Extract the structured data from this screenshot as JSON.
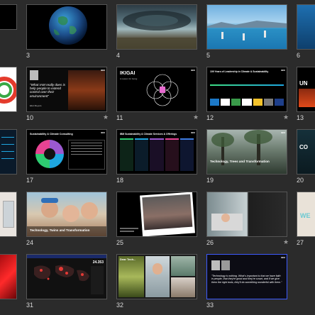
{
  "slides": [
    {
      "number": "3"
    },
    {
      "number": "4"
    },
    {
      "number": "5"
    },
    {
      "number": "6"
    },
    {
      "number": "10",
      "quote": "\"What IAM really does is help people to extend control over their environment\"",
      "author": "Eliot Meyers"
    },
    {
      "number": "11",
      "title": "IKIGAI",
      "subtitle": "A reason for being"
    },
    {
      "number": "12",
      "title": "109 Years of Leadership in Climate & Sustainability"
    },
    {
      "number": "13",
      "title": "UN"
    },
    {
      "number": "17",
      "title": "Sustainability & Climate Consulting"
    },
    {
      "number": "18",
      "title": "IBM Sustainability & Climate Services & Offerings"
    },
    {
      "number": "19",
      "title": "Technology, Trees and Transformation"
    },
    {
      "number": "20",
      "title": "CO"
    },
    {
      "number": "24",
      "title": "Technology, Twins and Transformation"
    },
    {
      "number": "25"
    },
    {
      "number": "26"
    },
    {
      "number": "27",
      "title": "WE"
    },
    {
      "number": "31",
      "stat": "24.353"
    },
    {
      "number": "32",
      "title": "Dear Tech..."
    },
    {
      "number": "33",
      "quote": "\"Technology is nothing. What's important is that we have faith in people, that they're good and they're smart, and if we give them the right tools, they'll do something wonderful with them.\""
    }
  ],
  "brand": "IBM",
  "star_symbol": "★"
}
